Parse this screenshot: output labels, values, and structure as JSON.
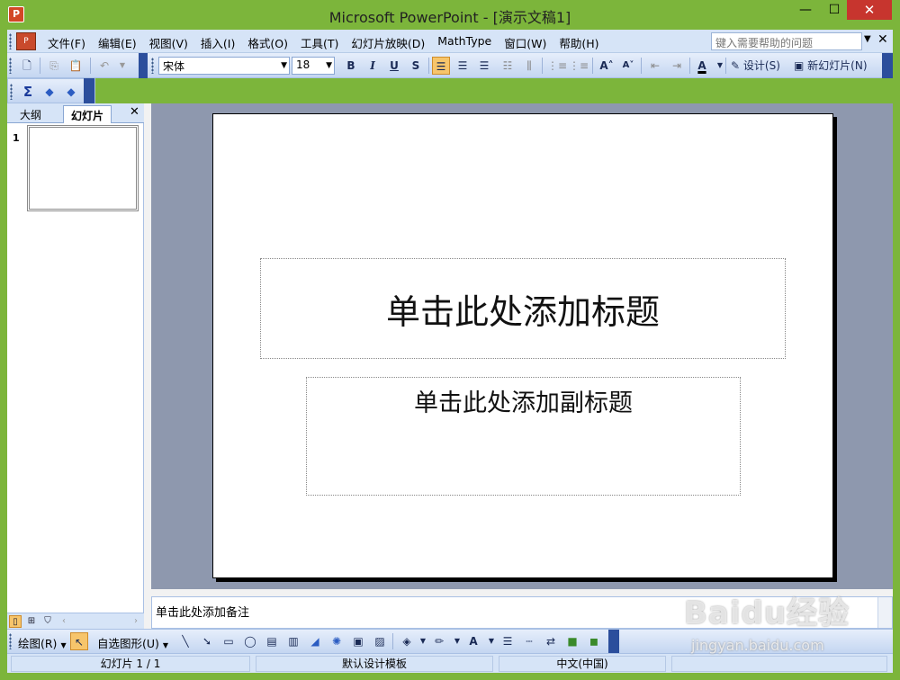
{
  "window": {
    "title": "Microsoft PowerPoint - [演示文稿1]",
    "minimize": "—",
    "maximize": "☐",
    "close": "✕"
  },
  "menubar": {
    "items": [
      "文件(F)",
      "编辑(E)",
      "视图(V)",
      "插入(I)",
      "格式(O)",
      "工具(T)",
      "幻灯片放映(D)",
      "MathType",
      "窗口(W)",
      "帮助(H)"
    ],
    "help_placeholder": "键入需要帮助的问题",
    "close": "✕"
  },
  "toolbar": {
    "font": "宋体",
    "size": "18",
    "bold": "B",
    "italic": "I",
    "underline": "U",
    "shadow": "S",
    "design_label": "设计(S)",
    "new_slide_label": "新幻灯片(N)"
  },
  "left_pane": {
    "tab_outline": "大纲",
    "tab_slides": "幻灯片",
    "close": "✕",
    "slide_number": "1"
  },
  "slide": {
    "title_placeholder": "单击此处添加标题",
    "subtitle_placeholder": "单击此处添加副标题"
  },
  "notes": {
    "placeholder": "单击此处添加备注"
  },
  "drawbar": {
    "draw_label": "绘图(R)",
    "autoshape_label": "自选图形(U)"
  },
  "statusbar": {
    "slide_indicator": "幻灯片 1 / 1",
    "template": "默认设计模板",
    "language": "中文(中国)"
  },
  "watermark": {
    "brand": "Baidu经验",
    "url": "jingyan.baidu.com"
  },
  "colors": {
    "frame": "#7cb53b",
    "toolbar": "#d6e4f7",
    "workspace": "#8e98ae",
    "close_button": "#c7352e"
  }
}
